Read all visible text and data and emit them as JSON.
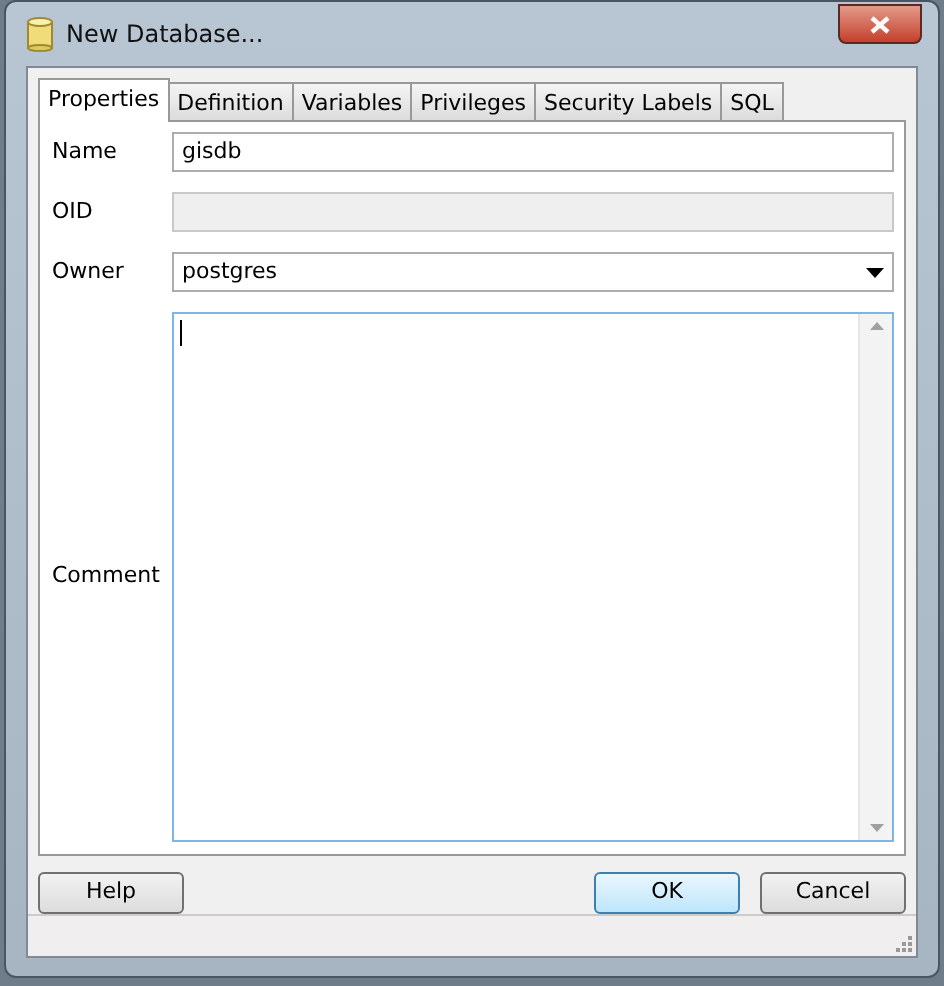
{
  "window": {
    "title": "New Database..."
  },
  "tabs": [
    {
      "label": "Properties",
      "selected": true
    },
    {
      "label": "Definition",
      "selected": false
    },
    {
      "label": "Variables",
      "selected": false
    },
    {
      "label": "Privileges",
      "selected": false
    },
    {
      "label": "Security Labels",
      "selected": false
    },
    {
      "label": "SQL",
      "selected": false
    }
  ],
  "fields": [
    {
      "label": "Name",
      "kind": "text",
      "value": "gisdb"
    },
    {
      "label": "OID",
      "kind": "disabled"
    },
    {
      "label": "Owner",
      "kind": "dropdown",
      "value": "postgres"
    },
    {
      "label": "Comment",
      "kind": "textarea"
    }
  ],
  "buttons": [
    {
      "label": "Help",
      "default": false
    },
    {
      "label": "OK",
      "default": true
    },
    {
      "label": "Cancel",
      "default": false
    }
  ]
}
